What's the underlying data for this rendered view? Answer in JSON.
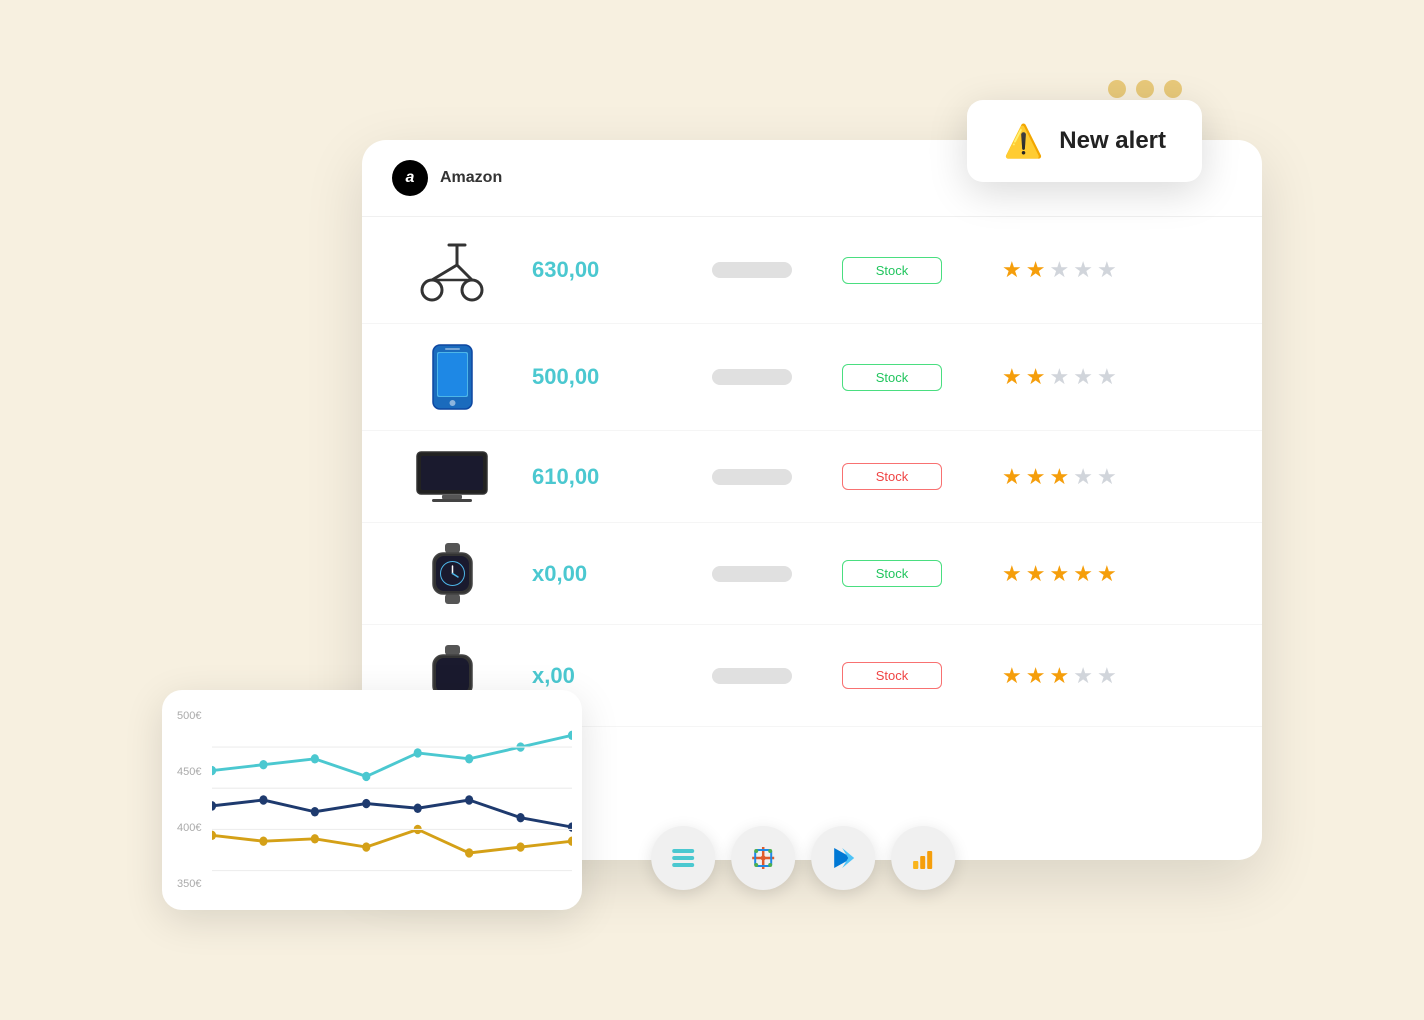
{
  "window": {
    "dots": [
      "dot1",
      "dot2",
      "dot3"
    ],
    "title": "Amazon"
  },
  "alert": {
    "icon": "⚠️",
    "title": "New alert"
  },
  "products": [
    {
      "id": "scooter",
      "price": "630,00",
      "stock_label": "Stock",
      "stock_type": "green",
      "stars_filled": 2,
      "stars_empty": 3
    },
    {
      "id": "phone",
      "price": "500,00",
      "stock_label": "Stock",
      "stock_type": "green",
      "stars_filled": 2,
      "stars_empty": 3
    },
    {
      "id": "tv",
      "price": "610,00",
      "stock_label": "Stock",
      "stock_type": "red",
      "stars_filled": 3,
      "stars_empty": 2
    },
    {
      "id": "watch",
      "price": "x0,00",
      "stock_label": "Stock",
      "stock_type": "green",
      "stars_filled": 5,
      "stars_empty": 0
    },
    {
      "id": "item5",
      "price": "x,00",
      "stock_label": "Stock",
      "stock_type": "red",
      "stars_filled": 3,
      "stars_empty": 2
    }
  ],
  "chart": {
    "y_labels": [
      "500€",
      "450€",
      "400€",
      "350€"
    ]
  },
  "tools": [
    {
      "id": "layout",
      "label": "Layout tool"
    },
    {
      "id": "tableau",
      "label": "Tableau"
    },
    {
      "id": "power-automate",
      "label": "Power Automate"
    },
    {
      "id": "power-bi",
      "label": "Power BI"
    }
  ]
}
